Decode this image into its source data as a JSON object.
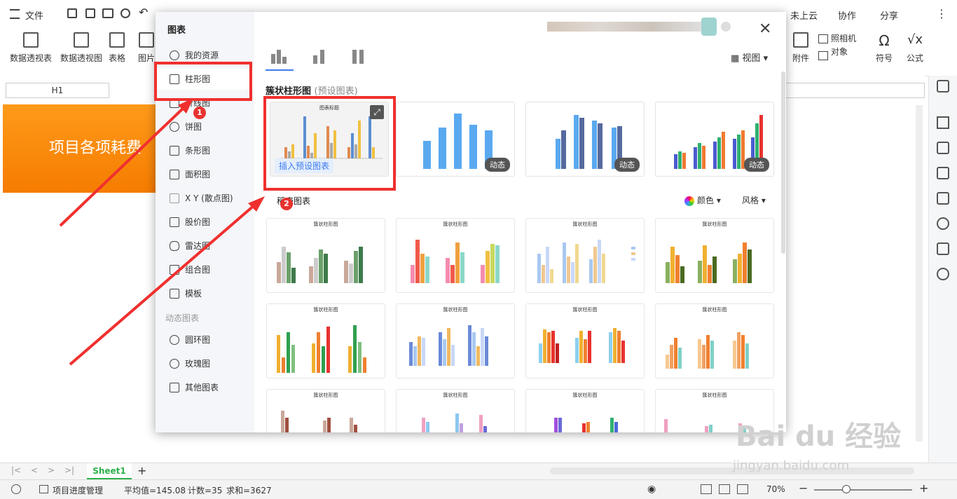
{
  "topbar": {
    "menu_label": "文件",
    "right": [
      "未上云",
      "协作",
      "分享"
    ]
  },
  "ribbon": {
    "left_items": [
      "数据透视表",
      "数据透视图",
      "表格",
      "图片"
    ],
    "right_items": [
      "附件",
      "照相机",
      "对象",
      "符号",
      "公式"
    ]
  },
  "formula": {
    "cell_ref": "H1"
  },
  "sheet": {
    "banner_text": "项目各项耗费"
  },
  "tabs": {
    "sheet_name": "Sheet1"
  },
  "status": {
    "doc_name": "项目进度管理",
    "average": "平均值=145.08",
    "count": "计数=35",
    "sum": "求和=3627",
    "zoom": "70%"
  },
  "dialog": {
    "title": "图表",
    "nav": [
      "我的资源",
      "柱形图",
      "折线图",
      "饼图",
      "条形图",
      "面积图",
      "X Y (散点图)",
      "股价图",
      "雷达图",
      "组合图",
      "模板"
    ],
    "dynamic_label": "动态图表",
    "dynamic_nav": [
      "圆环图",
      "玫瑰图",
      "其他图表"
    ],
    "view_label": "视图",
    "section_title": "簇状柱形图",
    "section_sub": "(预设图表)",
    "insert_label": "插入预设图表",
    "dynamic_badge": "动态",
    "recommend_title": "稻壳图表",
    "color_label": "颜色",
    "style_label": "风格",
    "card_title": "簇状柱形图",
    "preset_title": "图表标题"
  },
  "annotations": [
    "1",
    "2"
  ],
  "watermark": {
    "brand": "Bai du 经验",
    "url": "jingyan.baidu.com"
  }
}
